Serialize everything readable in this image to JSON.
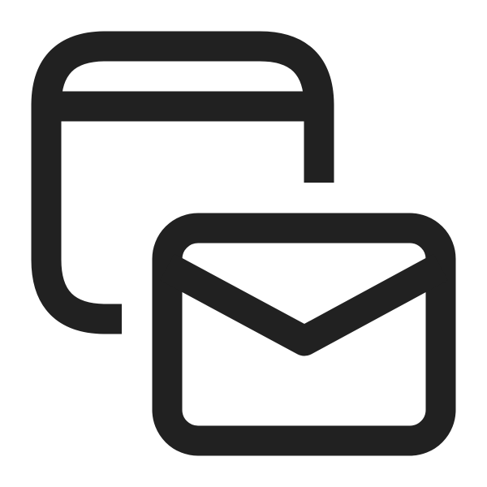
{
  "icon": {
    "name": "calendar-mail-icon",
    "stroke_color": "#212121",
    "background_color": "#ffffff",
    "parts": [
      "calendar-window-icon",
      "envelope-icon"
    ]
  }
}
